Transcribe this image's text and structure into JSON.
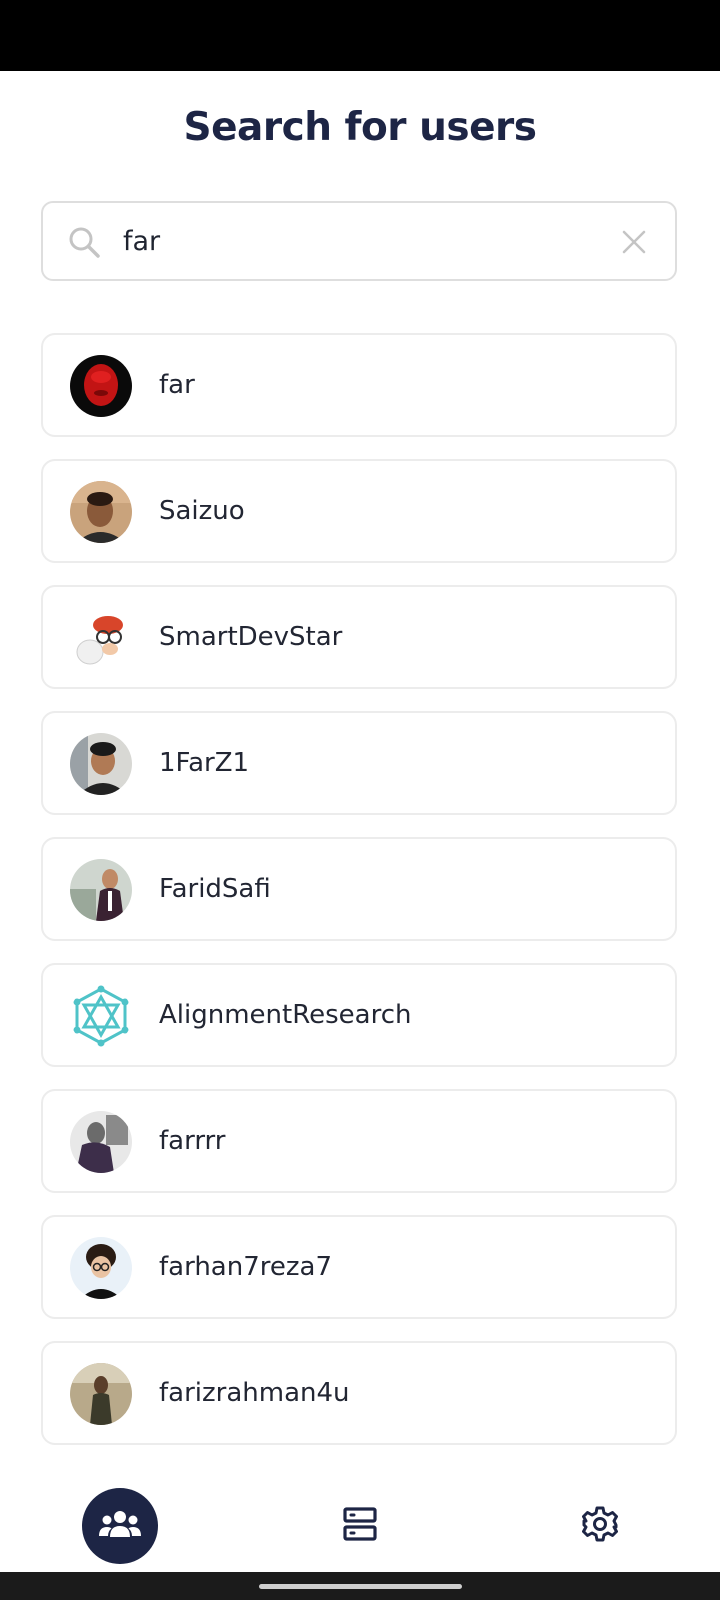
{
  "header": {
    "title": "Search for users"
  },
  "search": {
    "value": "far",
    "placeholder": ""
  },
  "results": [
    {
      "username": "far",
      "avatar_icon": "user-avatar-red-face"
    },
    {
      "username": "Saizuo",
      "avatar_icon": "user-avatar-photo"
    },
    {
      "username": "SmartDevStar",
      "avatar_icon": "user-avatar-cartoon"
    },
    {
      "username": "1FarZ1",
      "avatar_icon": "user-avatar-photo"
    },
    {
      "username": "FaridSafi",
      "avatar_icon": "user-avatar-photo"
    },
    {
      "username": "AlignmentResearch",
      "avatar_icon": "user-avatar-network-logo"
    },
    {
      "username": "farrrr",
      "avatar_icon": "user-avatar-photo"
    },
    {
      "username": "farhan7reza7",
      "avatar_icon": "user-avatar-cartoon"
    },
    {
      "username": "farizrahman4u",
      "avatar_icon": "user-avatar-photo"
    }
  ],
  "bottom_nav": {
    "items": [
      {
        "icon": "users-icon",
        "active": true
      },
      {
        "icon": "servers-icon",
        "active": false
      },
      {
        "icon": "gear-icon",
        "active": false
      }
    ]
  },
  "colors": {
    "primary": "#1d2545",
    "card_border": "#ececec",
    "accent_teal": "#4fc3c8"
  }
}
